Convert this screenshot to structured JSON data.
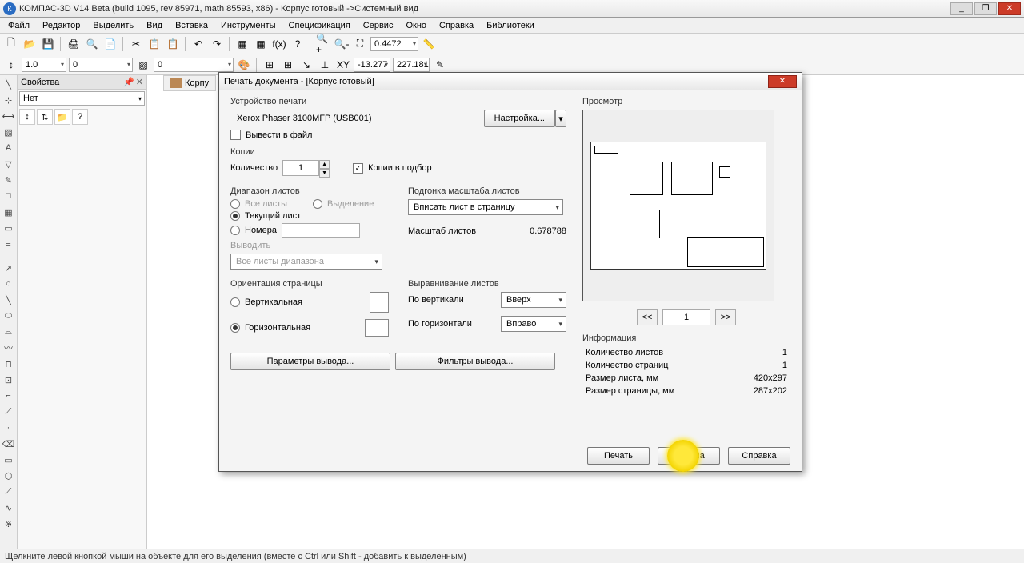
{
  "window": {
    "title": "КОМПАС-3D V14 Beta (build 1095, rev 85971, math 85593, x86) - Корпус готовый ->Системный вид"
  },
  "menu": [
    "Файл",
    "Редактор",
    "Выделить",
    "Вид",
    "Вставка",
    "Инструменты",
    "Спецификация",
    "Сервис",
    "Окно",
    "Справка",
    "Библиотеки"
  ],
  "toolbar2": {
    "combo1": "1.0",
    "combo2": "0",
    "combo3": "0"
  },
  "toolbar1": {
    "zoom": "0.4472",
    "coordX": "-13.277",
    "coordY": "227.181"
  },
  "props": {
    "title": "Свойства",
    "combo": "Нет"
  },
  "doctab": "Корпу",
  "dialog": {
    "title": "Печать документа - [Корпус готовый]",
    "device_section": "Устройство печати",
    "printer": "Xerox Phaser 3100MFP (USB001)",
    "settings_btn": "Настройка...",
    "output_file": "Вывести в файл",
    "copies_section": "Копии",
    "qty_label": "Количество",
    "qty_value": "1",
    "collate": "Копии в подбор",
    "range_section": "Диапазон листов",
    "range_all": "Все листы",
    "range_sel": "Выделение",
    "range_current": "Текущий лист",
    "range_numbers": "Номера",
    "output_label": "Выводить",
    "output_combo": "Все листы диапазона",
    "fit_section": "Подгонка масштаба листов",
    "fit_combo": "Вписать лист в страницу",
    "scale_label": "Масштаб листов",
    "scale_value": "0.678788",
    "orient_section": "Ориентация страницы",
    "orient_v": "Вертикальная",
    "orient_h": "Горизонтальная",
    "align_section": "Выравнивание листов",
    "align_v_label": "По вертикали",
    "align_v": "Вверх",
    "align_h_label": "По горизонтали",
    "align_h": "Вправо",
    "params_btn": "Параметры вывода...",
    "filters_btn": "Фильтры вывода...",
    "preview_label": "Просмотр",
    "page_num": "1",
    "prev_btn": "<<",
    "next_btn": ">>",
    "info_section": "Информация",
    "info_sheets_l": "Количество листов",
    "info_sheets_v": "1",
    "info_pages_l": "Количество страниц",
    "info_pages_v": "1",
    "info_sheet_size_l": "Размер листа, мм",
    "info_sheet_size_v": "420x297",
    "info_page_size_l": "Размер страницы, мм",
    "info_page_size_v": "287x202",
    "print_btn": "Печать",
    "cancel_btn": "Отмена",
    "help_btn": "Справка"
  },
  "status": "Щелкните левой кнопкой мыши на объекте для его выделения (вместе с Ctrl или Shift - добавить к выделенным)"
}
